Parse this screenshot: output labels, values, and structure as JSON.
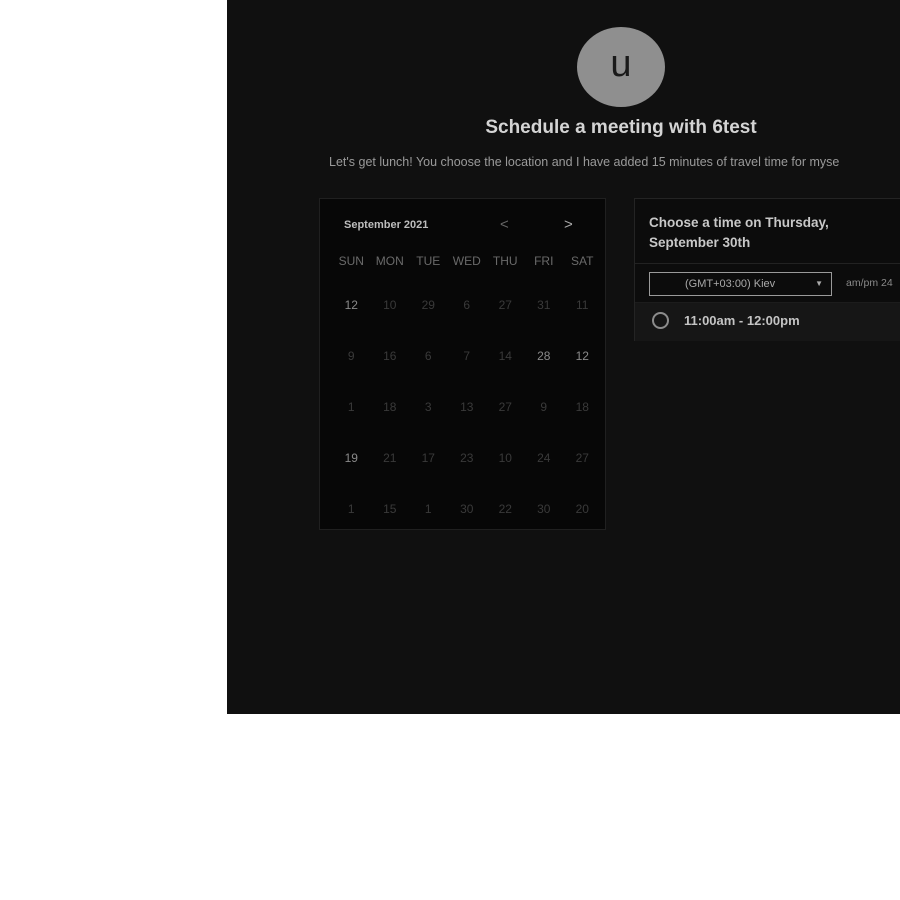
{
  "header": {
    "avatar_letter": "u",
    "title": "Schedule a meeting with 6test",
    "description": "Let's get lunch! You choose the location and I have added 15 minutes of travel time for myse"
  },
  "calendar": {
    "month_label": "September 2021",
    "prev_icon": "<",
    "next_icon": ">",
    "weekdays": [
      "SUN",
      "MON",
      "TUE",
      "WED",
      "THU",
      "FRI",
      "SAT"
    ],
    "weeks": [
      [
        "12",
        "10",
        "29",
        "6",
        "27",
        "31",
        "11"
      ],
      [
        "9",
        "16",
        "6",
        "7",
        "14",
        "28",
        "12"
      ],
      [
        "1",
        "18",
        "3",
        "13",
        "27",
        "9",
        "18"
      ],
      [
        "19",
        "21",
        "17",
        "23",
        "10",
        "24",
        "27"
      ],
      [
        "1",
        "15",
        "1",
        "30",
        "22",
        "30",
        "20"
      ]
    ]
  },
  "time_picker": {
    "heading_line1": "Choose a time on Thursday,",
    "heading_line2": "September 30th",
    "timezone": "(GMT+03:00) Kiev",
    "format_toggle": "am/pm  24",
    "slots": [
      {
        "label": "11:00am - 12:00pm"
      }
    ]
  }
}
